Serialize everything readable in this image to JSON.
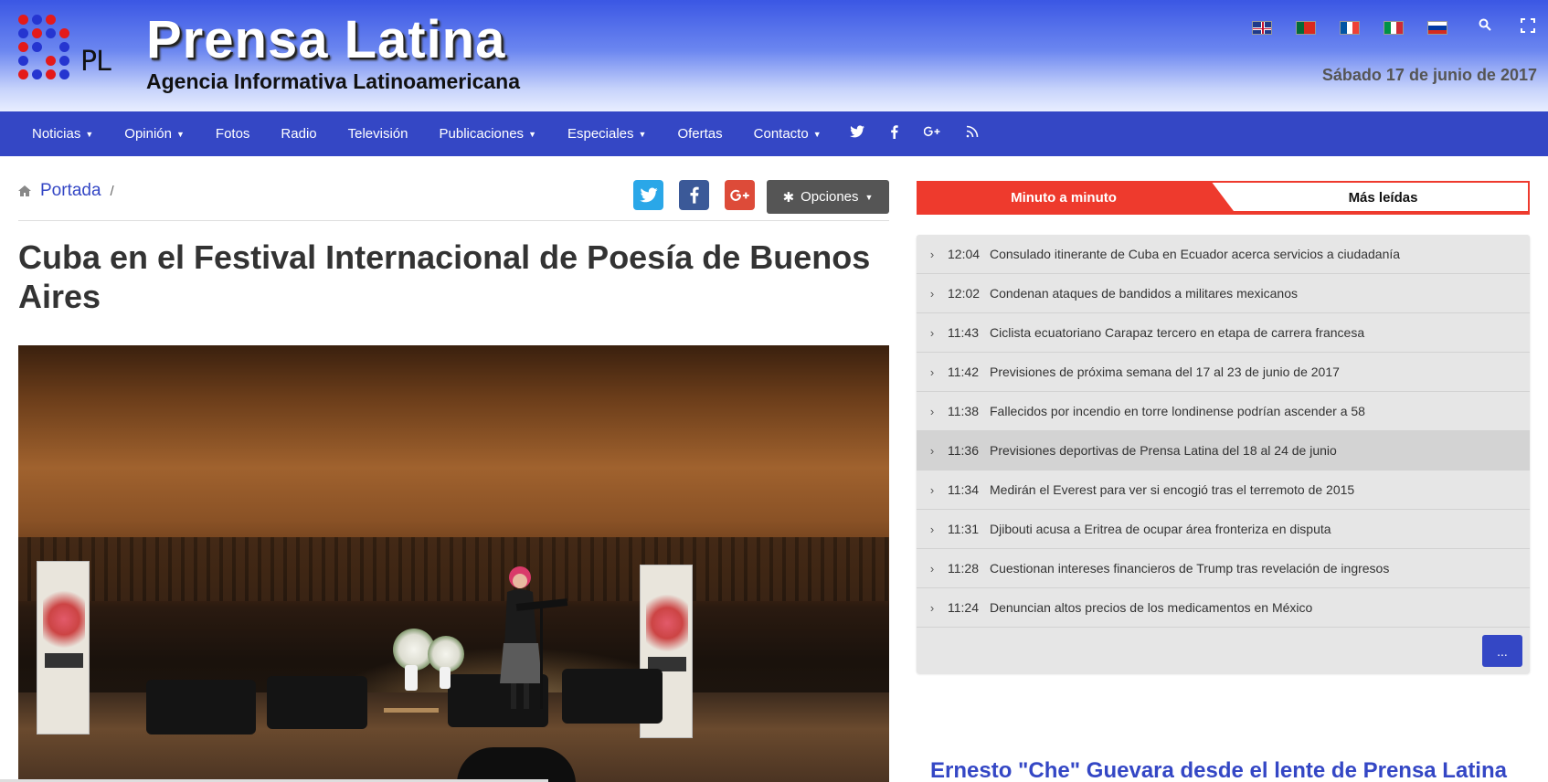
{
  "header": {
    "logo_text": "PL",
    "site_title": "Prensa Latina",
    "site_subtitle": "Agencia Informativa Latinoamericana",
    "date": "Sábado 17 de junio de 2017",
    "languages": [
      "english-flag",
      "portuguese-flag",
      "french-flag",
      "italian-flag",
      "russian-flag"
    ],
    "icons": [
      "search-icon",
      "fullscreen-icon"
    ]
  },
  "nav": {
    "items": [
      {
        "label": "Noticias",
        "dropdown": true
      },
      {
        "label": "Opinión",
        "dropdown": true
      },
      {
        "label": "Fotos",
        "dropdown": false
      },
      {
        "label": "Radio",
        "dropdown": false
      },
      {
        "label": "Televisión",
        "dropdown": false
      },
      {
        "label": "Publicaciones",
        "dropdown": true
      },
      {
        "label": "Especiales",
        "dropdown": true
      },
      {
        "label": "Ofertas",
        "dropdown": false
      },
      {
        "label": "Contacto",
        "dropdown": true
      }
    ],
    "social_icons": [
      "twitter-icon",
      "facebook-icon",
      "google-plus-icon",
      "rss-icon"
    ]
  },
  "breadcrumb": {
    "home": "Portada",
    "separator": "/"
  },
  "share": {
    "buttons": [
      {
        "name": "twitter-share",
        "glyph": "🐦",
        "color": "#2aa7e8"
      },
      {
        "name": "facebook-share",
        "glyph": "f",
        "color": "#3b5998"
      },
      {
        "name": "googleplus-share",
        "glyph": "G+",
        "color": "#dd4b39"
      }
    ],
    "options_label": "Opciones"
  },
  "article": {
    "title": "Cuba en el Festival Internacional de Poesía de Buenos Aires"
  },
  "sidebar": {
    "tabs": [
      "Minuto a minuto",
      "Más leídas"
    ],
    "active_tab": "Minuto a minuto",
    "news": [
      {
        "time": "12:04",
        "text": "Consulado itinerante de Cuba en Ecuador acerca servicios a ciudadanía"
      },
      {
        "time": "12:02",
        "text": "Condenan ataques de bandidos a militares mexicanos"
      },
      {
        "time": "11:43",
        "text": "Ciclista ecuatoriano Carapaz tercero en etapa de carrera francesa"
      },
      {
        "time": "11:42",
        "text": "Previsiones de próxima semana del 17 al 23 de junio de 2017"
      },
      {
        "time": "11:38",
        "text": "Fallecidos por incendio en torre londinense podrían ascender a 58"
      },
      {
        "time": "11:36",
        "text": "Previsiones deportivas de Prensa Latina del 18 al 24 de junio"
      },
      {
        "time": "11:34",
        "text": "Medirán el Everest para ver si encogió tras el terremoto de 2015"
      },
      {
        "time": "11:31",
        "text": "Djibouti acusa a Eritrea de ocupar área fronteriza en disputa"
      },
      {
        "time": "11:28",
        "text": "Cuestionan intereses financieros de Trump tras revelación de ingresos"
      },
      {
        "time": "11:24",
        "text": "Denuncian altos precios de los medicamentos en México"
      }
    ],
    "highlighted_index": 5,
    "more_label": "...",
    "promo_title": "Ernesto \"Che\" Guevara desde el lente de Prensa Latina"
  },
  "colors": {
    "nav_bg": "#3447c5",
    "accent_red": "#ee3a2d",
    "link_blue": "#3447c5"
  }
}
